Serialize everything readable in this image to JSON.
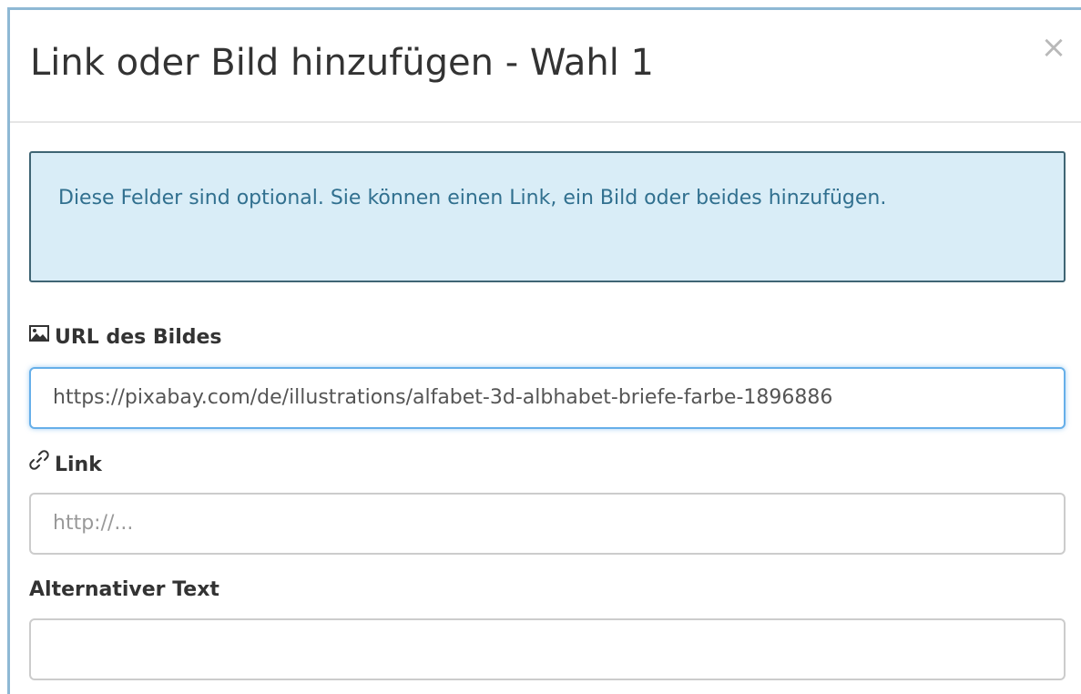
{
  "dialog": {
    "title": "Link oder Bild hinzufügen - Wahl 1",
    "close_label": "×"
  },
  "alert": {
    "text": "Diese Felder sind optional. Sie können einen Link, ein Bild oder beides hinzufügen."
  },
  "fields": {
    "image_url": {
      "label": "URL des Bildes",
      "icon": "picture-icon",
      "value": "https://pixabay.com/de/illustrations/alfabet-3d-albhabet-briefe-farbe-1896886"
    },
    "link": {
      "label": "Link",
      "icon": "link-icon",
      "placeholder": "http://..."
    },
    "alt_text": {
      "label": "Alternativer Text",
      "value": ""
    }
  },
  "colors": {
    "alert_bg": "#d9edf7",
    "alert_text": "#31708f",
    "focus_border": "#66afe9"
  }
}
